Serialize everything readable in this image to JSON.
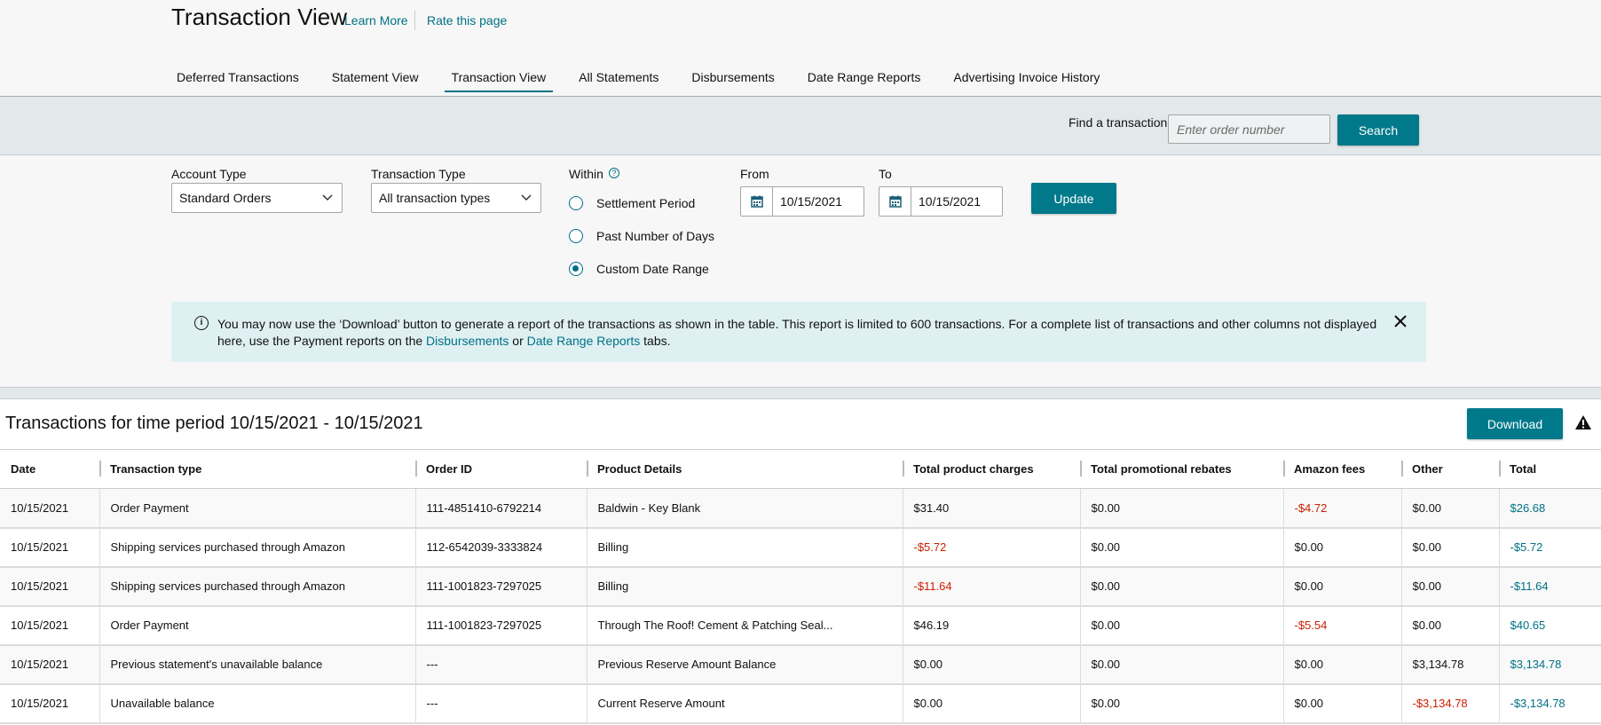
{
  "header": {
    "title": "Transaction View",
    "learn_more": "Learn More",
    "rate_page": "Rate this page"
  },
  "tabs": [
    {
      "label": "Deferred Transactions"
    },
    {
      "label": "Statement View"
    },
    {
      "label": "Transaction View",
      "active": true
    },
    {
      "label": "All Statements"
    },
    {
      "label": "Disbursements"
    },
    {
      "label": "Date Range Reports"
    },
    {
      "label": "Advertising Invoice History"
    }
  ],
  "search": {
    "label": "Find a transaction",
    "placeholder": "Enter order number",
    "button": "Search"
  },
  "filters": {
    "account_type_label": "Account Type",
    "account_type_value": "Standard Orders",
    "transaction_type_label": "Transaction Type",
    "transaction_type_value": "All transaction types",
    "within_label": "Within",
    "options": [
      "Settlement Period",
      "Past Number of Days",
      "Custom Date Range"
    ],
    "selected_option": "Custom Date Range",
    "from_label": "From",
    "from_value": "10/15/2021",
    "to_label": "To",
    "to_value": "10/15/2021",
    "update_button": "Update"
  },
  "info": {
    "text_part1": "You may now use the ‘Download’ button to generate a report of the transactions as shown in the table. This report is limited to 600 transactions. For a complete list of transactions and other columns not displayed here, use the Payment reports on the ",
    "link1": "Disbursements",
    "text_part2": " or ",
    "link2": "Date Range Reports",
    "text_part3": " tabs."
  },
  "results": {
    "title": "Transactions for time period 10/15/2021 - 10/15/2021",
    "download_button": "Download",
    "columns": [
      "Date",
      "Transaction type",
      "Order ID",
      "Product Details",
      "Total product charges",
      "Total promotional rebates",
      "Amazon fees",
      "Other",
      "Total"
    ],
    "rows": [
      [
        "10/15/2021",
        "Order Payment",
        "111-4851410-6792214",
        "Baldwin - Key Blank",
        "$31.40",
        "$0.00",
        "-$4.72",
        "$0.00",
        "$26.68"
      ],
      [
        "10/15/2021",
        "Shipping services purchased through Amazon",
        "112-6542039-3333824",
        "Billing",
        "-$5.72",
        "$0.00",
        "$0.00",
        "$0.00",
        "-$5.72"
      ],
      [
        "10/15/2021",
        "Shipping services purchased through Amazon",
        "111-1001823-7297025",
        "Billing",
        "-$11.64",
        "$0.00",
        "$0.00",
        "$0.00",
        "-$11.64"
      ],
      [
        "10/15/2021",
        "Order Payment",
        "111-1001823-7297025",
        "Through The Roof! Cement & Patching Seal...",
        "$46.19",
        "$0.00",
        "-$5.54",
        "$0.00",
        "$40.65"
      ],
      [
        "10/15/2021",
        "Previous statement's unavailable balance",
        "---",
        "Previous Reserve Amount Balance",
        "$0.00",
        "$0.00",
        "$0.00",
        "$3,134.78",
        "$3,134.78"
      ],
      [
        "10/15/2021",
        "Unavailable balance",
        "---",
        "Current Reserve Amount",
        "$0.00",
        "$0.00",
        "$0.00",
        "-$3,134.78",
        "-$3,134.78"
      ]
    ]
  },
  "colors": {
    "accent": "#007185",
    "button": "#00798a",
    "negative": "#cc1f00"
  }
}
